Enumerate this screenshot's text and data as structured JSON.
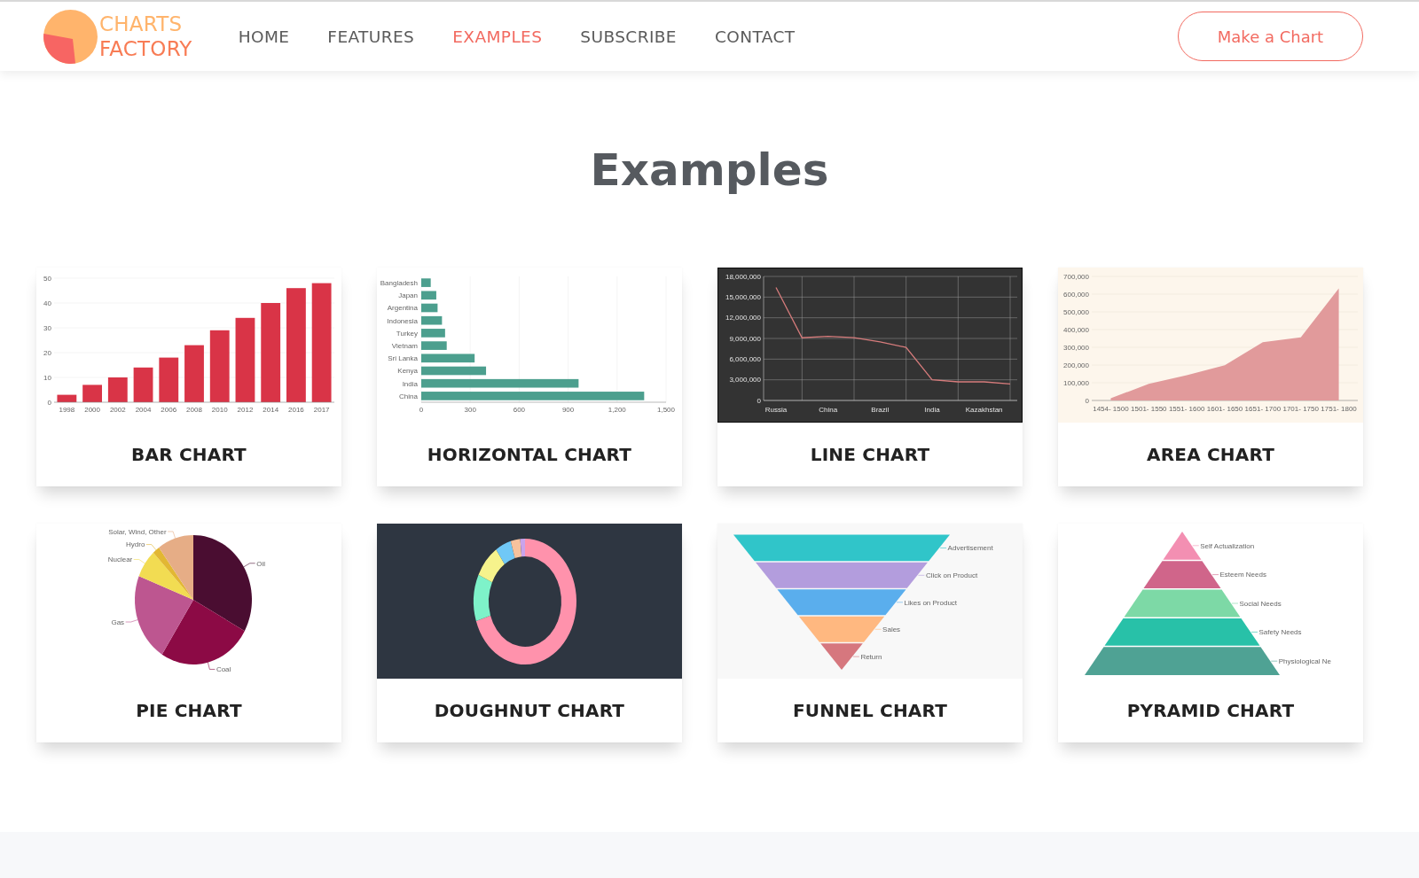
{
  "header": {
    "logo": {
      "line_1": "CHARTS",
      "line_2": "FACTORY"
    },
    "nav": [
      {
        "label": "HOME",
        "selected": false
      },
      {
        "label": "FEATURES",
        "selected": false
      },
      {
        "label": "EXAMPLES",
        "selected": true
      },
      {
        "label": "SUBSCRIBE",
        "selected": false
      },
      {
        "label": "CONTACT",
        "selected": false
      }
    ],
    "cta_button": "Make a Chart"
  },
  "section": {
    "title": "Examples"
  },
  "cards": [
    {
      "kind": "chart",
      "title": "BAR CHART",
      "chart_data": {
        "type": "bar",
        "categories": [
          "1998",
          "2000",
          "2002",
          "2004",
          "2006",
          "2008",
          "2010",
          "2012",
          "2014",
          "2016",
          "2017"
        ],
        "values": [
          3,
          7,
          10,
          14,
          18,
          23,
          29,
          34,
          40,
          46,
          48
        ],
        "ylim": [
          0,
          50
        ],
        "yticks": [
          0,
          10,
          20,
          30,
          40,
          50
        ],
        "grid": true
      }
    },
    {
      "kind": "chart",
      "title": "HORIZONTAL CHART",
      "chart_data": {
        "type": "bar",
        "orientation": "horizontal",
        "categories": [
          "Bangladesh",
          "Japan",
          "Argentina",
          "Indonesia",
          "Turkey",
          "Vietnam",
          "Sri Lanka",
          "Kenya",
          "India",
          "China"
        ],
        "values": [
          58,
          92,
          100,
          127,
          146,
          156,
          327,
          397,
          964,
          1366
        ],
        "xlim": [
          0,
          1500
        ],
        "xticks": [
          {
            "value": 0,
            "label": "0"
          },
          {
            "value": 300,
            "label": "300"
          },
          {
            "value": 600,
            "label": "600"
          },
          {
            "value": 900,
            "label": "900"
          },
          {
            "value": 1200,
            "label": "1,200"
          },
          {
            "value": 1500,
            "label": "1,500"
          }
        ],
        "grid": true
      }
    },
    {
      "kind": "chart",
      "title": "LINE CHART",
      "chart_data": {
        "type": "line",
        "categories": [
          "Russia",
          null,
          "China",
          null,
          "Brazil",
          null,
          "India",
          null,
          "Kazakhstan",
          null
        ],
        "values": [
          16400000,
          9100000,
          9300000,
          9100000,
          8500000,
          7700000,
          3000000,
          2700000,
          2700000,
          2400000
        ],
        "ylim": [
          0,
          18000000
        ],
        "yticks": [
          {
            "value": 0,
            "label": "0"
          },
          {
            "value": 3000000,
            "label": "3,000,000"
          },
          {
            "value": 6000000,
            "label": "6,000,000"
          },
          {
            "value": 9000000,
            "label": "9,000,000"
          },
          {
            "value": 12000000,
            "label": "12,000,000"
          },
          {
            "value": 15000000,
            "label": "15,000,000"
          },
          {
            "value": 18000000,
            "label": "18,000,000"
          }
        ],
        "grid": true
      }
    },
    {
      "kind": "chart",
      "title": "AREA CHART",
      "chart_data": {
        "type": "area",
        "categories": [
          "1454- 1500",
          "1501- 1550",
          "1551- 1600",
          "1601- 1650",
          "1651- 1700",
          "1701- 1750",
          "1751- 1800"
        ],
        "values": [
          12000,
          94000,
          142000,
          199000,
          329000,
          356000,
          632000
        ],
        "ylim": [
          0,
          700000
        ],
        "yticks": [
          {
            "value": 0,
            "label": "0"
          },
          {
            "value": 100000,
            "label": "100,000"
          },
          {
            "value": 200000,
            "label": "200,000"
          },
          {
            "value": 300000,
            "label": "300,000"
          },
          {
            "value": 400000,
            "label": "400,000"
          },
          {
            "value": 500000,
            "label": "500,000"
          },
          {
            "value": 600000,
            "label": "600,000"
          },
          {
            "value": 700000,
            "label": "700,000"
          }
        ],
        "grid": true
      }
    },
    {
      "kind": "chart",
      "title": "PIE CHART",
      "chart_data": {
        "type": "pie",
        "categories": [
          "Oil",
          "Coal",
          "Gas",
          "Nuclear",
          "Hydro",
          "Solar, Wind, Other"
        ],
        "values": [
          33,
          26,
          22,
          7,
          2,
          10
        ],
        "colors": [
          "#4a0d31",
          "#8c0a45",
          "#bd5690",
          "#f2dc52",
          "#e2b733",
          "#e6ad86"
        ]
      }
    },
    {
      "kind": "chart",
      "title": "DOUGHNUT CHART",
      "chart_data": {
        "type": "donut",
        "values": [
          70,
          12,
          8.5,
          5,
          3,
          1.5
        ],
        "colors": [
          "#ff92ac",
          "#7ef2c9",
          "#f6f38c",
          "#70c8f6",
          "#f6c29d",
          "#c9a3ec"
        ]
      }
    },
    {
      "kind": "funnel",
      "title": "FUNNEL CHART",
      "stages": [
        {
          "label": "Advertisement",
          "color": "#30c5c9"
        },
        {
          "label": "Click on Product",
          "color": "#b39ddd"
        },
        {
          "label": "Likes on Product",
          "color": "#5aaeed"
        },
        {
          "label": "Sales",
          "color": "#ffb880"
        },
        {
          "label": "Return",
          "color": "#d6777e"
        }
      ]
    },
    {
      "kind": "pyramid",
      "title": "PYRAMID CHART",
      "stages": [
        {
          "label": "Self Actualization",
          "color": "#f38fb2"
        },
        {
          "label": "Esteem Needs",
          "color": "#d0658a"
        },
        {
          "label": "Social Needs",
          "color": "#7dd9a6"
        },
        {
          "label": "Safety Needs",
          "color": "#28c1a8"
        },
        {
          "label": "Physiological Ne",
          "color": "#4fa294"
        }
      ]
    }
  ]
}
